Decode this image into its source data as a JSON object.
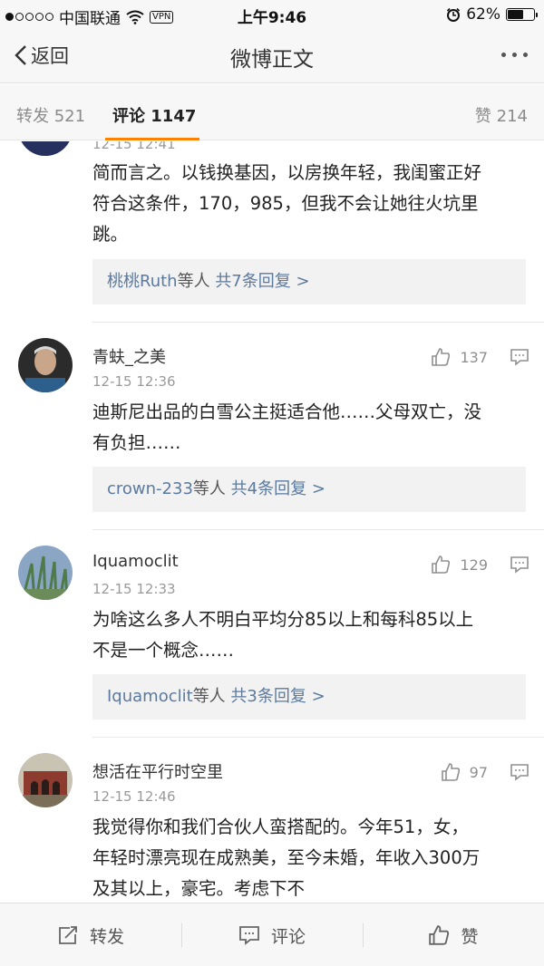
{
  "status_bar": {
    "carrier": "中国联通",
    "vpn": "VPN",
    "time": "上午9:46",
    "battery": "62%",
    "battery_level": 0.62
  },
  "nav": {
    "back_label": "返回",
    "title": "微博正文"
  },
  "tabs": {
    "repost_label": "转发",
    "repost_count": "521",
    "comment_label": "评论",
    "comment_count": "1147",
    "like_label": "赞",
    "like_count": "214"
  },
  "comments": [
    {
      "time": "12-15 12:41",
      "lines": [
        "简而言之。以钱换基因，以房换年轻，我闺蜜正好",
        "符合这条件，170，985，但我不会让她往火坑里",
        "跳。"
      ],
      "replies": {
        "who": "桃桃Ruth",
        "etc": "等人",
        "count": "共7条回复 >"
      }
    },
    {
      "name": "青蚨_之美",
      "time": "12-15 12:36",
      "likes": "137",
      "lines": [
        "迪斯尼出品的白雪公主挺适合他……父母双亡，没",
        "有负担……"
      ],
      "replies": {
        "who": "crown-233",
        "etc": "等人",
        "count": "共4条回复 >"
      }
    },
    {
      "name": "Iquamoclit",
      "time": "12-15 12:33",
      "likes": "129",
      "lines": [
        "为啥这么多人不明白平均分85以上和每科85以上",
        "不是一个概念……"
      ],
      "replies": {
        "who": "Iquamoclit",
        "etc": "等人",
        "count": "共3条回复 >"
      }
    },
    {
      "name": "想活在平行时空里",
      "time": "12-15 12:46",
      "likes": "97",
      "lines": [
        "我觉得你和我们合伙人蛮搭配的。今年51，女，",
        "年轻时漂亮现在成熟美，至今未婚，年收入300万",
        "及其以上，豪宅。考虑下不"
      ]
    }
  ],
  "toolbar": {
    "repost": "转发",
    "comment": "评论",
    "like": "赞"
  },
  "colors": {
    "accent": "#ff8200",
    "link": "#5b7a9e",
    "meta": "#9a9a9a"
  }
}
